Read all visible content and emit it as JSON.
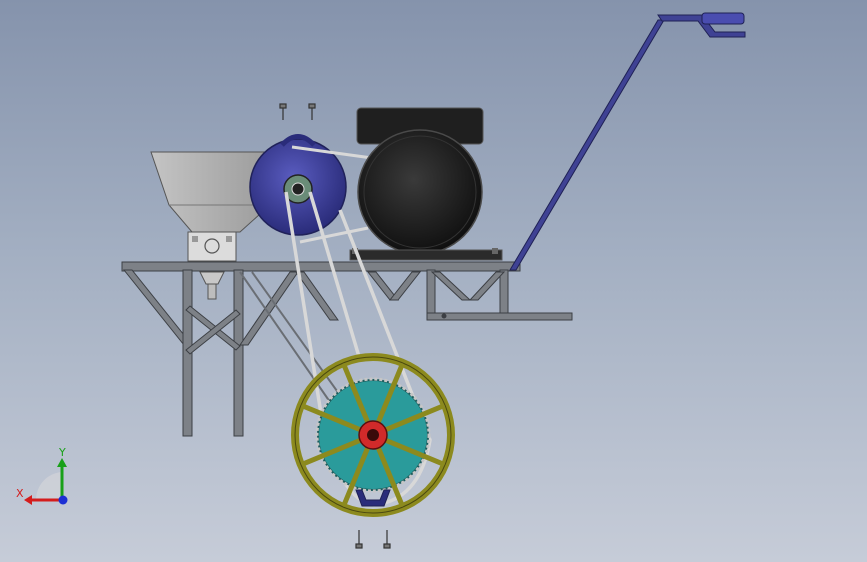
{
  "viewport": {
    "background_top": "#8593ac",
    "background_bottom": "#c6ccd8"
  },
  "model": {
    "parts": [
      "hopper",
      "motor",
      "pulley-drive",
      "belt-drive",
      "frame",
      "handle",
      "spoked-wheel",
      "sprocket-wheel",
      "bolts"
    ],
    "colors": {
      "frame": "#7d8187",
      "hopper": "#b0b0b0",
      "motor": "#1f1f1f",
      "pulley": "#3d3f9a",
      "handle": "#3f4294",
      "wheel_rim": "#8c8a1e",
      "sprocket": "#2a9b9b",
      "hub": "#d12a2a"
    }
  },
  "triad": {
    "y_label": "Y",
    "x_label": "X",
    "y_color": "#19a019",
    "x_color": "#d41c1c",
    "z_color": "#1c2fd4"
  }
}
